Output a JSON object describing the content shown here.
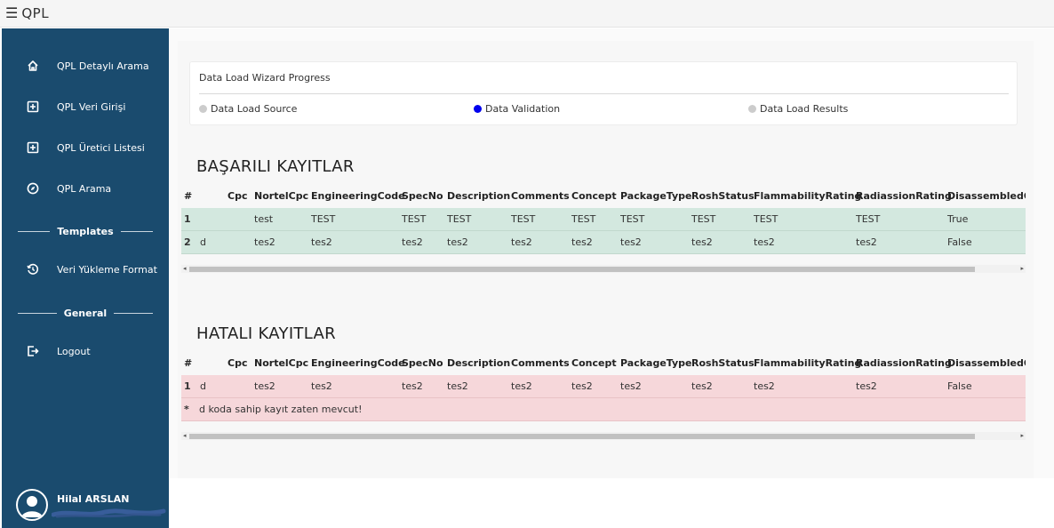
{
  "app": {
    "menu_icon": "hamburger-icon",
    "title": "QPL"
  },
  "sidebar": {
    "items": [
      {
        "label": "QPL Detaylı Arama",
        "icon": "home-icon"
      },
      {
        "label": "QPL Veri Girişi",
        "icon": "plus-square-icon"
      },
      {
        "label": "QPL Üretici Listesi",
        "icon": "plus-square-icon"
      },
      {
        "label": "QPL Arama",
        "icon": "compass-icon"
      }
    ],
    "section_templates": "Templates",
    "templates_items": [
      {
        "label": "Veri Yükleme Format",
        "icon": "history-icon"
      }
    ],
    "section_general": "General",
    "general_items": [
      {
        "label": "Logout",
        "icon": "logout-icon"
      }
    ],
    "user": {
      "name": "Hilal ARSLAN"
    }
  },
  "wizard": {
    "title": "Data Load Wizard Progress",
    "steps": [
      {
        "label": "Data Load Source",
        "color": "#cccccc"
      },
      {
        "label": "Data Validation",
        "color": "#0000ee"
      },
      {
        "label": "Data Load Results",
        "color": "#cccccc"
      }
    ]
  },
  "success": {
    "title": "BAŞARILI KAYITLAR",
    "columns": [
      "#",
      "Cpc",
      "NortelCpc",
      "EngineeringCode",
      "SpecNo",
      "Description",
      "Comments",
      "Concept",
      "PackageType",
      "RoshStatus",
      "FlammabilityRating",
      "RadiassionRating",
      "DisassembledOrI"
    ],
    "rows": [
      [
        "1",
        "",
        "test",
        "TEST",
        "TEST",
        "TEST",
        "TEST",
        "TEST",
        "TEST",
        "TEST",
        "TEST",
        "TEST",
        "True"
      ],
      [
        "2",
        "d",
        "tes2",
        "tes2",
        "tes2",
        "tes2",
        "tes2",
        "tes2",
        "tes2",
        "tes2",
        "tes2",
        "tes2",
        "False"
      ]
    ]
  },
  "errors": {
    "title": "HATALI KAYITLAR",
    "columns": [
      "#",
      "Cpc",
      "NortelCpc",
      "EngineeringCode",
      "SpecNo",
      "Description",
      "Comments",
      "Concept",
      "PackageType",
      "RoshStatus",
      "FlammabilityRating",
      "RadiassionRating",
      "DisassembledOrI"
    ],
    "rows": [
      [
        "1",
        "d",
        "tes2",
        "tes2",
        "tes2",
        "tes2",
        "tes2",
        "tes2",
        "tes2",
        "tes2",
        "tes2",
        "tes2",
        "False"
      ]
    ],
    "messages": [
      {
        "bullet": "*",
        "text": "d koda sahip kayıt zaten mevcut!"
      }
    ]
  }
}
